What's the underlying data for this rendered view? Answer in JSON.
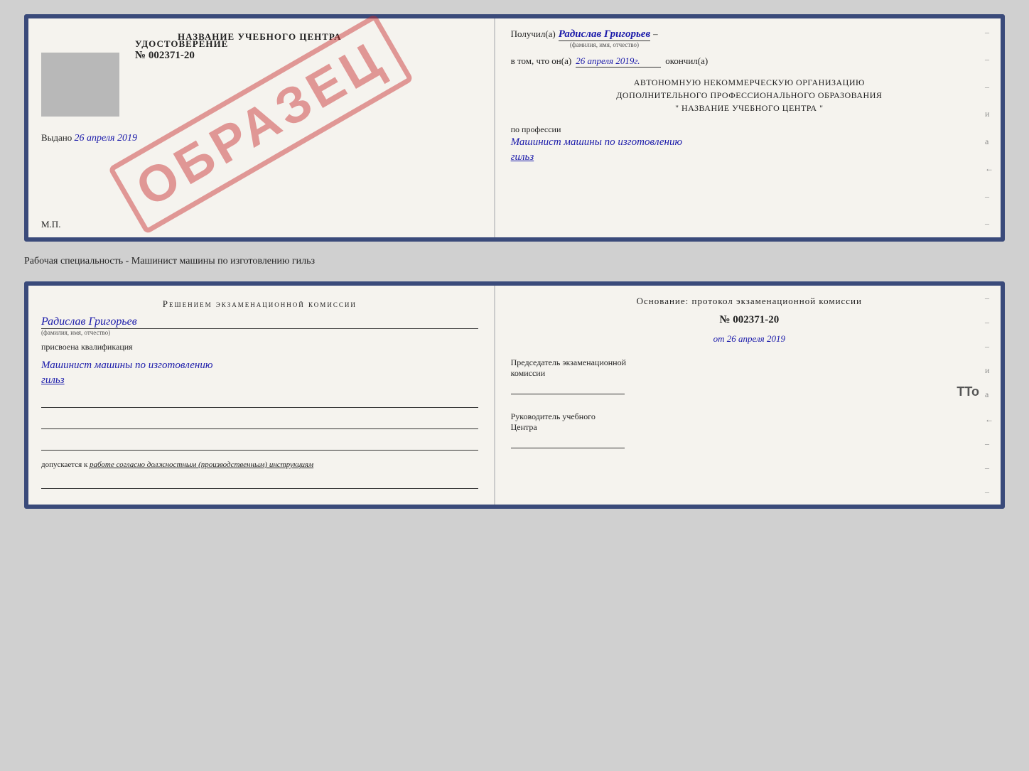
{
  "top_doc": {
    "left": {
      "title": "НАЗВАНИЕ УЧЕБНОГО ЦЕНТРА",
      "stamp_label": "УДОСТОВЕРЕНИЕ",
      "stamp_number": "№ 002371-20",
      "vydano_label": "Выдано",
      "vydano_date": "26 апреля 2019",
      "mp_label": "М.П.",
      "obrazec": "ОБРАЗЕЦ"
    },
    "right": {
      "poluchil_prefix": "Получил(а)",
      "poluchil_name": "Радислав Григорьев",
      "fio_hint": "(фамилия, имя, отчество)",
      "vtom_prefix": "в том, что он(а)",
      "vtom_date": "26 апреля 2019г.",
      "okoncil_suffix": "окончил(а)",
      "org_line1": "АВТОНОМНУЮ НЕКОММЕРЧЕСКУЮ ОРГАНИЗАЦИЮ",
      "org_line2": "ДОПОЛНИТЕЛЬНОГО ПРОФЕССИОНАЛЬНОГО ОБРАЗОВАНИЯ",
      "org_name": "\"  НАЗВАНИЕ УЧЕБНОГО ЦЕНТРА  \"",
      "po_professii": "по профессии",
      "profession_text": "Машинист машины по изготовлению",
      "profession_text2": "гильз"
    }
  },
  "subtitle": "Рабочая специальность - Машинист машины по изготовлению гильз",
  "bottom_doc": {
    "left": {
      "resheniem_title": "Решением  экзаменационной  комиссии",
      "name": "Радислав Григорьев",
      "fio_hint": "(фамилия, имя, отчество)",
      "prisvoena_label": "присвоена квалификация",
      "kvali_text": "Машинист машины по изготовлению",
      "kvali_text2": "гильз",
      "dopuskaetsya_prefix": "допускается к",
      "dopuskaetsya_text": "работе согласно должностным (производственным) инструкциям"
    },
    "right": {
      "osnovanie_title": "Основание:  протокол  экзаменационной  комиссии",
      "number": "№  002371-20",
      "ot_prefix": "от",
      "ot_date": "26 апреля 2019",
      "predsedatel_line1": "Председатель экзаменационной",
      "predsedatel_line2": "комиссии",
      "rukovoditel_line1": "Руководитель учебного",
      "rukovoditel_line2": "Центра",
      "tto": "TTo"
    }
  },
  "dashes": [
    "-",
    "-",
    "-",
    "и",
    "а",
    "←",
    "-",
    "-",
    "-"
  ]
}
